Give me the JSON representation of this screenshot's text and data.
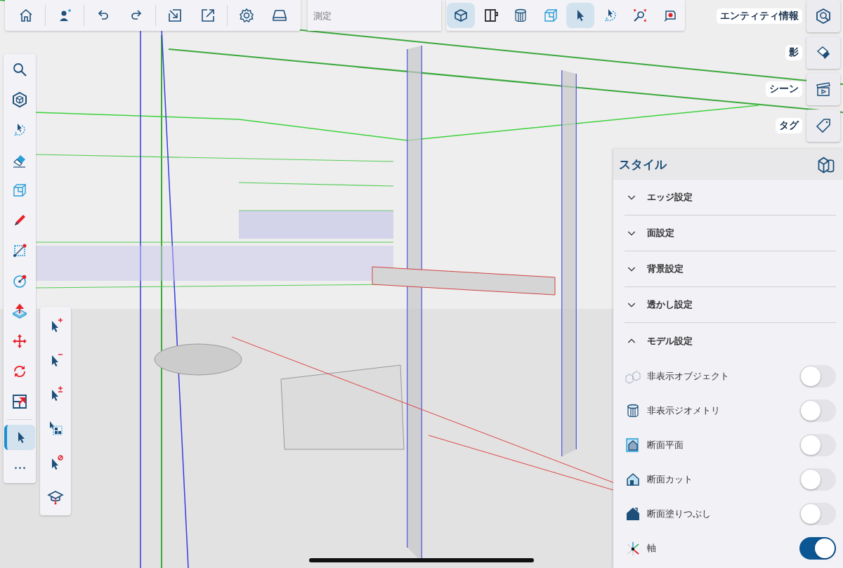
{
  "top_toolbar": {
    "groups": [
      [
        {
          "kind": "home",
          "selected": false
        }
      ],
      [
        {
          "kind": "adduser",
          "selected": false
        }
      ],
      [
        {
          "kind": "undo",
          "selected": false
        },
        {
          "kind": "redo",
          "selected": false
        }
      ],
      [
        {
          "kind": "import",
          "selected": false
        },
        {
          "kind": "export",
          "selected": false
        }
      ],
      [
        {
          "kind": "settings",
          "selected": false
        },
        {
          "kind": "tray",
          "selected": false
        }
      ]
    ]
  },
  "measure_field": {
    "placeholder": "測定"
  },
  "view_toolbar": {
    "tools": [
      {
        "kind": "box",
        "selected": true
      },
      {
        "kind": "panel",
        "selected": false
      },
      {
        "kind": "cylinder",
        "selected": false
      },
      {
        "kind": "wirebox",
        "selected": false
      },
      {
        "kind": "cursor",
        "selected": true
      },
      {
        "kind": "lasso",
        "selected": false
      },
      {
        "kind": "zoomextents",
        "selected": false
      },
      {
        "kind": "tape",
        "selected": false
      }
    ]
  },
  "side_buttons": [
    {
      "label": "エンティティ情報",
      "kind": "entity"
    },
    {
      "label": "影",
      "kind": "shadow"
    },
    {
      "label": "シーン",
      "kind": "clapper"
    },
    {
      "label": "タグ",
      "kind": "tag"
    }
  ],
  "left_toolbar": {
    "groups": [
      [
        {
          "kind": "search",
          "selected": false
        },
        {
          "kind": "hexcube",
          "selected": false
        },
        {
          "kind": "lasso",
          "selected": false
        },
        {
          "kind": "eraser",
          "selected": false
        },
        {
          "kind": "wirebox",
          "selected": false
        },
        {
          "kind": "pencil",
          "selected": false
        },
        {
          "kind": "rectangle",
          "selected": false
        },
        {
          "kind": "circle",
          "selected": false
        },
        {
          "kind": "pushpull",
          "selected": false
        },
        {
          "kind": "move",
          "selected": false
        },
        {
          "kind": "rotate",
          "selected": false
        },
        {
          "kind": "scale",
          "selected": false
        }
      ],
      [
        {
          "kind": "cursor",
          "selected": true
        },
        {
          "kind": "more",
          "selected": false
        }
      ]
    ]
  },
  "selection_toolbar": {
    "tools": [
      {
        "kind": "cursorplus",
        "selected": false
      },
      {
        "kind": "cursorminus",
        "selected": false
      },
      {
        "kind": "cursorplusminus",
        "selected": false
      },
      {
        "kind": "cursorgrid",
        "selected": false
      },
      {
        "kind": "cursorblock",
        "selected": false
      },
      {
        "kind": "cap",
        "selected": false
      }
    ]
  },
  "style_panel": {
    "title": "スタイル",
    "sections": [
      {
        "label": "エッジ設定",
        "expanded": false
      },
      {
        "label": "面設定",
        "expanded": false
      },
      {
        "label": "背景設定",
        "expanded": false
      },
      {
        "label": "透かし設定",
        "expanded": false
      },
      {
        "label": "モデル設定",
        "expanded": true
      }
    ],
    "toggles": [
      {
        "label": "非表示オブジェクト",
        "kind": "hiddencubes",
        "checked": false
      },
      {
        "label": "非表示ジオメトリ",
        "kind": "cylinder",
        "checked": false
      },
      {
        "label": "断面平面",
        "kind": "sectionplane",
        "checked": false
      },
      {
        "label": "断面カット",
        "kind": "sectioncut",
        "checked": false
      },
      {
        "label": "断面塗りつぶし",
        "kind": "sectionfill",
        "checked": false
      },
      {
        "label": "軸",
        "kind": "axes",
        "checked": true
      }
    ]
  }
}
